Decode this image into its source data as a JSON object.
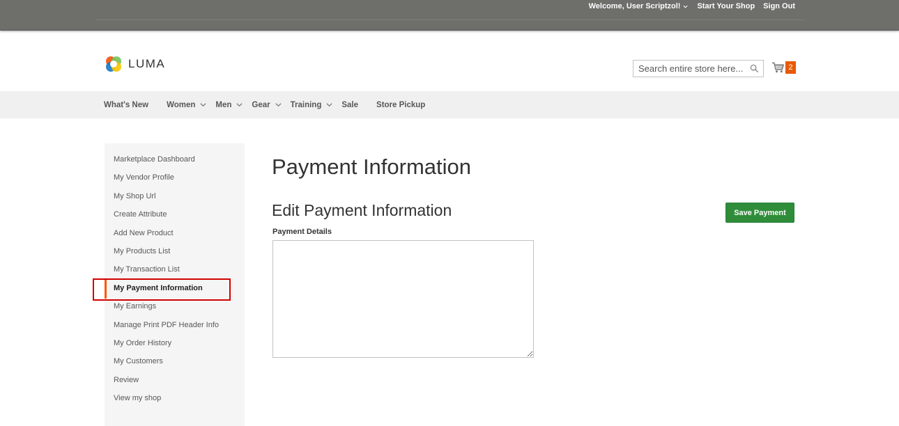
{
  "topbar": {
    "welcome": "Welcome, User Scriptzol!",
    "start_shop": "Start Your Shop",
    "sign_out": "Sign Out"
  },
  "header": {
    "logo_text": "LUMA",
    "search_placeholder": "Search entire store here...",
    "cart_count": "2"
  },
  "nav": {
    "items": [
      {
        "label": "What's New",
        "has_dropdown": false
      },
      {
        "label": "Women",
        "has_dropdown": true
      },
      {
        "label": "Men",
        "has_dropdown": true
      },
      {
        "label": "Gear",
        "has_dropdown": true
      },
      {
        "label": "Training",
        "has_dropdown": true
      },
      {
        "label": "Sale",
        "has_dropdown": false
      },
      {
        "label": "Store Pickup",
        "has_dropdown": false
      }
    ]
  },
  "sidebar": {
    "items": [
      {
        "label": "Marketplace Dashboard",
        "active": false
      },
      {
        "label": "My Vendor Profile",
        "active": false
      },
      {
        "label": "My Shop Url",
        "active": false
      },
      {
        "label": "Create Attribute",
        "active": false
      },
      {
        "label": "Add New Product",
        "active": false
      },
      {
        "label": "My Products List",
        "active": false
      },
      {
        "label": "My Transaction List",
        "active": false
      },
      {
        "label": "My Payment Information",
        "active": true
      },
      {
        "label": "My Earnings",
        "active": false
      },
      {
        "label": "Manage Print PDF Header Info",
        "active": false
      },
      {
        "label": "My Order History",
        "active": false
      },
      {
        "label": "My Customers",
        "active": false
      },
      {
        "label": "Review",
        "active": false
      },
      {
        "label": "View my shop",
        "active": false
      }
    ]
  },
  "main": {
    "page_title": "Payment Information",
    "section_title": "Edit Payment Information",
    "save_button": "Save Payment",
    "payment_details_label": "Payment Details",
    "payment_details_value": ""
  },
  "colors": {
    "topbar_bg": "#6e6f6b",
    "nav_bg": "#f0f0f0",
    "sidebar_bg": "#f5f5f5",
    "active_accent": "#ff5501",
    "save_button_bg": "#2f8d3a",
    "cart_counter_bg": "#e85a05",
    "highlight_border": "#d10000"
  },
  "icons": [
    "chevron-down-icon",
    "search-icon",
    "cart-icon",
    "luma-logo-icon"
  ]
}
